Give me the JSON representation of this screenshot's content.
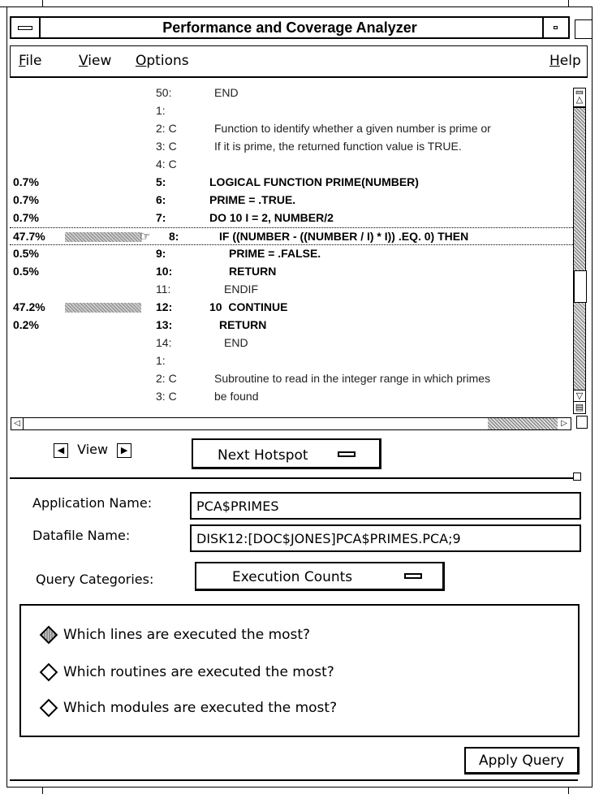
{
  "window": {
    "title": "Performance and Coverage Analyzer"
  },
  "menu": {
    "items": [
      {
        "label": "File",
        "mnemonic": "F",
        "rest": "ile"
      },
      {
        "label": "View",
        "mnemonic": "V",
        "rest": "iew"
      },
      {
        "label": "Options",
        "mnemonic": "O",
        "rest": "ptions"
      },
      {
        "label": "Help",
        "mnemonic": "H",
        "rest": "elp"
      }
    ]
  },
  "source": {
    "rows": [
      {
        "pct": "",
        "bar": 0,
        "line": "50:",
        "text": "END",
        "bold": false,
        "indent": 0
      },
      {
        "pct": "",
        "bar": 0,
        "line": "1:",
        "text": "",
        "bold": false,
        "indent": 0
      },
      {
        "pct": "",
        "bar": 0,
        "line": "2: C",
        "text": "Function to identify whether a given number is prime or",
        "bold": false,
        "indent": 0
      },
      {
        "pct": "",
        "bar": 0,
        "line": "3: C",
        "text": "If it is prime, the returned function value is TRUE.",
        "bold": false,
        "indent": 0
      },
      {
        "pct": "",
        "bar": 0,
        "line": "4: C",
        "text": "",
        "bold": false,
        "indent": 0
      },
      {
        "pct": "0.7%",
        "bar": 0,
        "line": "5:",
        "text": "LOGICAL FUNCTION PRIME(NUMBER)",
        "bold": true,
        "indent": 0
      },
      {
        "pct": "0.7%",
        "bar": 0,
        "line": "6:",
        "text": "PRIME = .TRUE.",
        "bold": true,
        "indent": 0
      },
      {
        "pct": "0.7%",
        "bar": 0,
        "line": "7:",
        "text": "DO 10 I = 2, NUMBER/2",
        "bold": true,
        "indent": 0
      },
      {
        "pct": "47.7%",
        "bar": 0.477,
        "line": "8:",
        "text": "IF ((NUMBER - ((NUMBER / I) * I)) .EQ. 0) THEN",
        "bold": true,
        "indent": 1,
        "current": true
      },
      {
        "pct": "0.5%",
        "bar": 0,
        "line": "9:",
        "text": "PRIME = .FALSE.",
        "bold": true,
        "indent": 2
      },
      {
        "pct": "0.5%",
        "bar": 0,
        "line": "10:",
        "text": "RETURN",
        "bold": true,
        "indent": 2
      },
      {
        "pct": "",
        "bar": 0,
        "line": "11:",
        "text": "ENDIF",
        "bold": false,
        "indent": 1
      },
      {
        "pct": "47.2%",
        "bar": 0.472,
        "line": "12:",
        "text": "10  CONTINUE",
        "bold": true,
        "indent": 0
      },
      {
        "pct": "0.2%",
        "bar": 0,
        "line": "13:",
        "text": "RETURN",
        "bold": true,
        "indent": 1
      },
      {
        "pct": "",
        "bar": 0,
        "line": "14:",
        "text": "END",
        "bold": false,
        "indent": 1
      },
      {
        "pct": "",
        "bar": 0,
        "line": "1:",
        "text": "",
        "bold": false,
        "indent": 0
      },
      {
        "pct": "",
        "bar": 0,
        "line": "2: C",
        "text": "Subroutine to read in the integer range in which primes",
        "bold": false,
        "indent": 0
      },
      {
        "pct": "",
        "bar": 0,
        "line": "3: C",
        "text": "be found",
        "bold": false,
        "indent": 0
      }
    ]
  },
  "nav": {
    "view_label": "View",
    "next_hotspot_label": "Next Hotspot"
  },
  "form": {
    "app_name_label": "Application Name:",
    "app_name_value": "PCA$PRIMES",
    "datafile_label": "Datafile Name:",
    "datafile_value": "DISK12:[DOC$JONES]PCA$PRIMES.PCA;9",
    "query_cat_label": "Query Categories:",
    "query_cat_value": "Execution Counts"
  },
  "queries": {
    "options": [
      {
        "label": "Which lines are executed the most?",
        "selected": true
      },
      {
        "label": "Which routines are executed the most?",
        "selected": false
      },
      {
        "label": "Which modules are executed the most?",
        "selected": false
      }
    ]
  },
  "actions": {
    "apply_label": "Apply Query"
  },
  "icons": {
    "window_menu": "window-menu-icon",
    "minimize": "minimize-icon",
    "maximize": "maximize-icon",
    "pointing_hand": "pointing-hand-icon",
    "option_menu": "option-menu-icon"
  }
}
